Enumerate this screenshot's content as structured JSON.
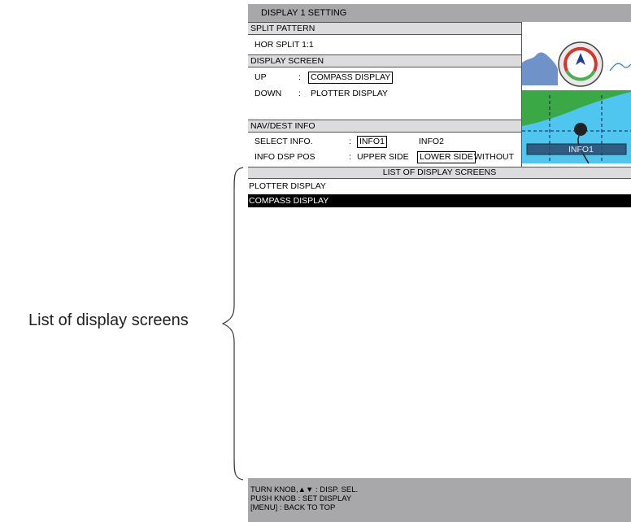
{
  "window": {
    "title": "DISPLAY 1 SETTING"
  },
  "split_pattern": {
    "heading": "SPLIT PATTERN",
    "value": "HOR SPLIT 1:1"
  },
  "display_screen": {
    "heading": "DISPLAY SCREEN",
    "up_label": "UP",
    "up_sep": ":",
    "up_value": "COMPASS DISPLAY",
    "down_label": "DOWN",
    "down_sep": ":",
    "down_value": "PLOTTER DISPLAY"
  },
  "nav_dest": {
    "heading": "NAV/DEST INFO",
    "select_label": "SELECT INFO.",
    "select_sep": ":",
    "select_options": [
      "INFO1",
      "INFO2"
    ],
    "select_selected": "INFO1",
    "pos_label": "INFO DSP POS",
    "pos_sep": ":",
    "pos_options": [
      "UPPER SIDE",
      "LOWER SIDE",
      "WITHOUT"
    ],
    "pos_selected": "LOWER SIDE"
  },
  "preview": {
    "info_label": "INFO1",
    "compass_icon": "compass-dial-icon",
    "plotter_icon": "plotter-map-icon"
  },
  "list": {
    "heading": "LIST OF DISPLAY SCREENS",
    "items": [
      "PLOTTER DISPLAY",
      "COMPASS DISPLAY"
    ],
    "selected_index": 1
  },
  "footer": {
    "line1": "TURN KNOB,▲▼ : DISP. SEL.",
    "line2": "PUSH KNOB : SET DISPLAY",
    "line3": "[MENU] : BACK TO TOP"
  },
  "annotation": {
    "label": "List of display screens"
  },
  "colors": {
    "title_bg": "#a8a8aa",
    "header_bg": "#dcdcde",
    "selected_bg": "#000000",
    "sea": "#4ec6f0",
    "land": "#3aa845",
    "compass_ring_green": "#4caf50",
    "compass_ring_red": "#d9342b",
    "compass_arrow": "#1a3f9b"
  }
}
